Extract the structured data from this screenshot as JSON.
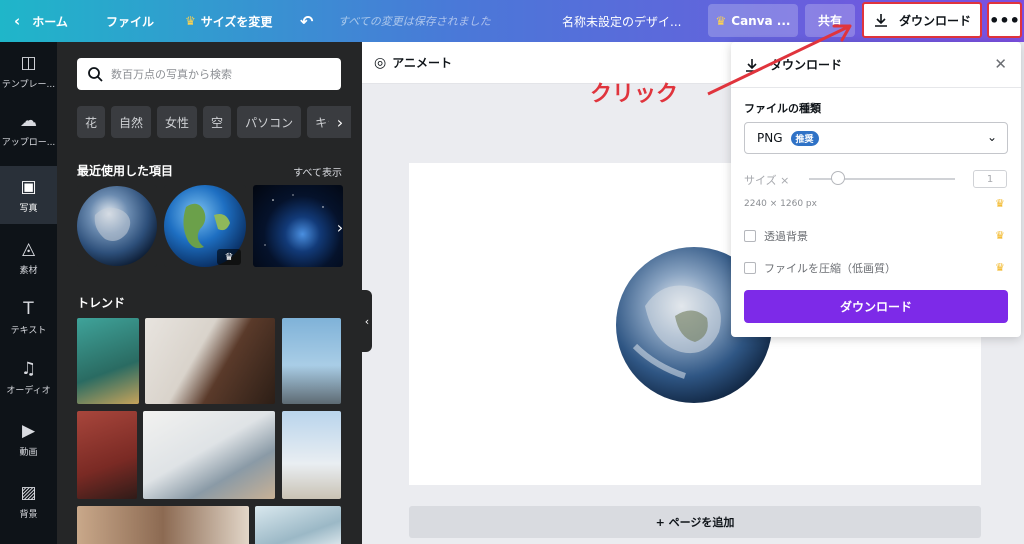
{
  "topbar": {
    "home_label": "ホーム",
    "file_label": "ファイル",
    "resize_label": "サイズを変更",
    "saved_status": "すべての変更は保存されました",
    "design_title": "名称未設定のデザイ...",
    "canva_pro_label": "Canva ...",
    "share_label": "共有",
    "download_label": "ダウンロード",
    "more_label": "•••"
  },
  "rail": {
    "items": [
      {
        "label": "テンプレー..."
      },
      {
        "label": "アップロー..."
      },
      {
        "label": "写真"
      },
      {
        "label": "素材"
      },
      {
        "label": "テキスト"
      },
      {
        "label": "オーディオ"
      },
      {
        "label": "動画"
      },
      {
        "label": "背景"
      }
    ]
  },
  "panel": {
    "search_placeholder": "数百万点の写真から検索",
    "chips": [
      "花",
      "自然",
      "女性",
      "空",
      "パソコン",
      "キラ"
    ],
    "recent_title": "最近使用した項目",
    "show_all": "すべて表示",
    "trend_title": "トレンド"
  },
  "editor": {
    "animate_label": "アニメート",
    "add_page_label": "+ ページを追加"
  },
  "download_panel": {
    "title": "ダウンロード",
    "file_type_label": "ファイルの種類",
    "file_type_value": "PNG",
    "recommended_badge": "推奨",
    "size_label": "サイズ ×",
    "size_value": "1",
    "dimensions": "2240 × 1260 px",
    "transparent_bg_label": "透過背景",
    "compress_label": "ファイルを圧縮（低画質）",
    "submit_label": "ダウンロード"
  },
  "annotation": {
    "text": "クリック"
  },
  "colors": {
    "accent_purple": "#7d2ae8",
    "annotation_red": "#e0343d",
    "crown_gold": "#f2b51f",
    "badge_blue": "#2f72c6"
  }
}
